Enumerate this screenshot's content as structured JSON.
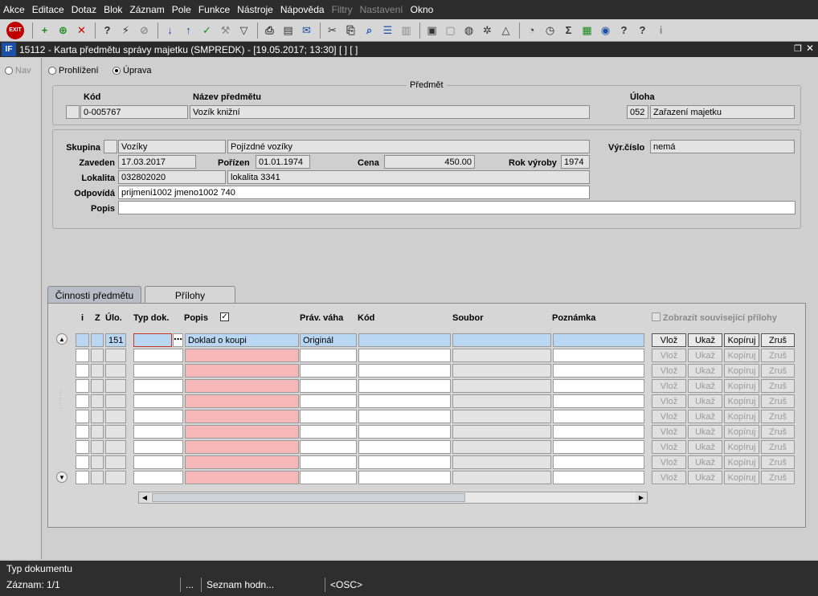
{
  "menu": [
    "Akce",
    "Editace",
    "Dotaz",
    "Blok",
    "Záznam",
    "Pole",
    "Funkce",
    "Nástroje",
    "Nápověda",
    "Filtry",
    "Nastavení",
    "Okno"
  ],
  "menu_disabled": [
    "Filtry",
    "Nastavení"
  ],
  "toolbar": {
    "exit": "EXIT"
  },
  "window": {
    "logo": "IF",
    "title": "15112 - Karta předmětu správy majetku (SMPREDK) - [19.05.2017; 13:30]  [ ]  [ ]",
    "restore": "❐",
    "close": "✕"
  },
  "nav": {
    "label": "Nav"
  },
  "mode": {
    "prohlizeni": "Prohlížení",
    "uprava": "Úprava",
    "selected": "Úprava"
  },
  "predmet": {
    "group_title": "Předmět",
    "kod_label": "Kód",
    "kod": "0-005767",
    "nazev_label": "Název předmětu",
    "nazev": "Vozík knižní",
    "uloha_label": "Úloha",
    "uloha_code": "052",
    "uloha_name": "Zařazení majetku"
  },
  "detail": {
    "skupina_label": "Skupina",
    "skupina": "Vozíky",
    "skupina_popis": "Pojízdné vozíky",
    "vyr_cislo_label": "Výr.číslo",
    "vyr_cislo": "nemá",
    "zaveden_label": "Zaveden",
    "zaveden": "17.03.2017",
    "porizen_label": "Pořízen",
    "porizen": "01.01.1974",
    "cena_label": "Cena",
    "cena": "450.00",
    "rok_vyroby_label": "Rok výroby",
    "rok_vyroby": "1974",
    "lokalita_label": "Lokalita",
    "lokalita": "032802020",
    "lokalita_popis": "lokalita 3341",
    "odpovida_label": "Odpovídá",
    "odpovida": "prijmeni1002 jmeno1002 740",
    "popis_label": "Popis",
    "popis": ""
  },
  "tabs": [
    {
      "label": "Činnosti předmětu",
      "active": false
    },
    {
      "label": "Přílohy",
      "active": true
    }
  ],
  "prilohy": {
    "columns": {
      "i": "i",
      "z": "Z",
      "ulo": "Úlo.",
      "typ_dok": "Typ dok.",
      "popis": "Popis",
      "prav_vaha": "Práv. váha",
      "kod": "Kód",
      "soubor": "Soubor",
      "poznamka": "Poznámka"
    },
    "popis_checked": true,
    "zobrazit_label": "Zobrazit související přílohy",
    "rows": [
      {
        "ulo": "151",
        "typ_dok": "",
        "popis": "Doklad o koupi",
        "prav_vaha": "Originál",
        "kod": "",
        "soubor": "",
        "poznamka": ""
      }
    ],
    "row_count": 10,
    "buttons": {
      "vloz": "Vlož",
      "ukaz": "Ukaž",
      "kopiruj": "Kopíruj",
      "zrus": "Zruš"
    }
  },
  "status": {
    "hint": "Typ dokumentu",
    "zaznam": "Záznam: 1/1",
    "dots": "...",
    "seznam": "Seznam hodn...",
    "osc": "<OSC>"
  }
}
